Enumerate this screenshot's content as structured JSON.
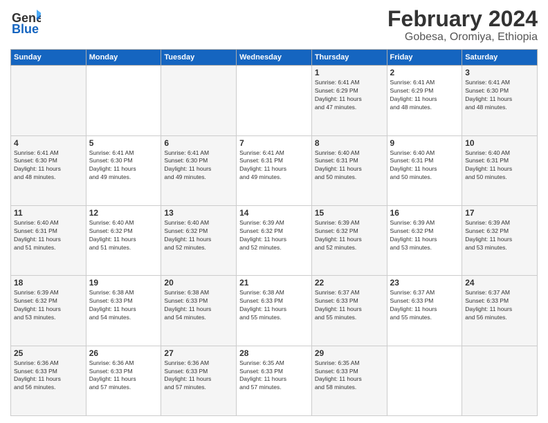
{
  "logo": {
    "line1": "General",
    "line2": "Blue"
  },
  "title": "February 2024",
  "location": "Gobesa, Oromiya, Ethiopia",
  "headers": [
    "Sunday",
    "Monday",
    "Tuesday",
    "Wednesday",
    "Thursday",
    "Friday",
    "Saturday"
  ],
  "weeks": [
    [
      {
        "day": "",
        "info": ""
      },
      {
        "day": "",
        "info": ""
      },
      {
        "day": "",
        "info": ""
      },
      {
        "day": "",
        "info": ""
      },
      {
        "day": "1",
        "info": "Sunrise: 6:41 AM\nSunset: 6:29 PM\nDaylight: 11 hours\nand 47 minutes."
      },
      {
        "day": "2",
        "info": "Sunrise: 6:41 AM\nSunset: 6:29 PM\nDaylight: 11 hours\nand 48 minutes."
      },
      {
        "day": "3",
        "info": "Sunrise: 6:41 AM\nSunset: 6:30 PM\nDaylight: 11 hours\nand 48 minutes."
      }
    ],
    [
      {
        "day": "4",
        "info": "Sunrise: 6:41 AM\nSunset: 6:30 PM\nDaylight: 11 hours\nand 48 minutes."
      },
      {
        "day": "5",
        "info": "Sunrise: 6:41 AM\nSunset: 6:30 PM\nDaylight: 11 hours\nand 49 minutes."
      },
      {
        "day": "6",
        "info": "Sunrise: 6:41 AM\nSunset: 6:30 PM\nDaylight: 11 hours\nand 49 minutes."
      },
      {
        "day": "7",
        "info": "Sunrise: 6:41 AM\nSunset: 6:31 PM\nDaylight: 11 hours\nand 49 minutes."
      },
      {
        "day": "8",
        "info": "Sunrise: 6:40 AM\nSunset: 6:31 PM\nDaylight: 11 hours\nand 50 minutes."
      },
      {
        "day": "9",
        "info": "Sunrise: 6:40 AM\nSunset: 6:31 PM\nDaylight: 11 hours\nand 50 minutes."
      },
      {
        "day": "10",
        "info": "Sunrise: 6:40 AM\nSunset: 6:31 PM\nDaylight: 11 hours\nand 50 minutes."
      }
    ],
    [
      {
        "day": "11",
        "info": "Sunrise: 6:40 AM\nSunset: 6:31 PM\nDaylight: 11 hours\nand 51 minutes."
      },
      {
        "day": "12",
        "info": "Sunrise: 6:40 AM\nSunset: 6:32 PM\nDaylight: 11 hours\nand 51 minutes."
      },
      {
        "day": "13",
        "info": "Sunrise: 6:40 AM\nSunset: 6:32 PM\nDaylight: 11 hours\nand 52 minutes."
      },
      {
        "day": "14",
        "info": "Sunrise: 6:39 AM\nSunset: 6:32 PM\nDaylight: 11 hours\nand 52 minutes."
      },
      {
        "day": "15",
        "info": "Sunrise: 6:39 AM\nSunset: 6:32 PM\nDaylight: 11 hours\nand 52 minutes."
      },
      {
        "day": "16",
        "info": "Sunrise: 6:39 AM\nSunset: 6:32 PM\nDaylight: 11 hours\nand 53 minutes."
      },
      {
        "day": "17",
        "info": "Sunrise: 6:39 AM\nSunset: 6:32 PM\nDaylight: 11 hours\nand 53 minutes."
      }
    ],
    [
      {
        "day": "18",
        "info": "Sunrise: 6:39 AM\nSunset: 6:32 PM\nDaylight: 11 hours\nand 53 minutes."
      },
      {
        "day": "19",
        "info": "Sunrise: 6:38 AM\nSunset: 6:33 PM\nDaylight: 11 hours\nand 54 minutes."
      },
      {
        "day": "20",
        "info": "Sunrise: 6:38 AM\nSunset: 6:33 PM\nDaylight: 11 hours\nand 54 minutes."
      },
      {
        "day": "21",
        "info": "Sunrise: 6:38 AM\nSunset: 6:33 PM\nDaylight: 11 hours\nand 55 minutes."
      },
      {
        "day": "22",
        "info": "Sunrise: 6:37 AM\nSunset: 6:33 PM\nDaylight: 11 hours\nand 55 minutes."
      },
      {
        "day": "23",
        "info": "Sunrise: 6:37 AM\nSunset: 6:33 PM\nDaylight: 11 hours\nand 55 minutes."
      },
      {
        "day": "24",
        "info": "Sunrise: 6:37 AM\nSunset: 6:33 PM\nDaylight: 11 hours\nand 56 minutes."
      }
    ],
    [
      {
        "day": "25",
        "info": "Sunrise: 6:36 AM\nSunset: 6:33 PM\nDaylight: 11 hours\nand 56 minutes."
      },
      {
        "day": "26",
        "info": "Sunrise: 6:36 AM\nSunset: 6:33 PM\nDaylight: 11 hours\nand 57 minutes."
      },
      {
        "day": "27",
        "info": "Sunrise: 6:36 AM\nSunset: 6:33 PM\nDaylight: 11 hours\nand 57 minutes."
      },
      {
        "day": "28",
        "info": "Sunrise: 6:35 AM\nSunset: 6:33 PM\nDaylight: 11 hours\nand 57 minutes."
      },
      {
        "day": "29",
        "info": "Sunrise: 6:35 AM\nSunset: 6:33 PM\nDaylight: 11 hours\nand 58 minutes."
      },
      {
        "day": "",
        "info": ""
      },
      {
        "day": "",
        "info": ""
      }
    ]
  ]
}
